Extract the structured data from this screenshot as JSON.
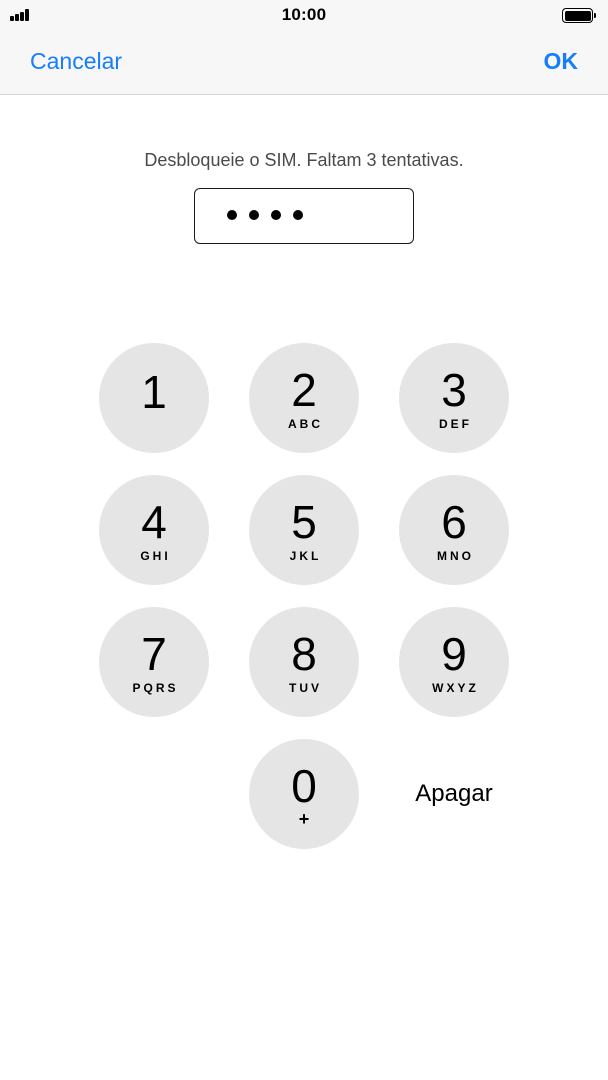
{
  "status_bar": {
    "time": "10:00",
    "signal_icon": "cellular-signal-icon",
    "battery_icon": "battery-full-icon"
  },
  "nav": {
    "cancel_label": "Cancelar",
    "ok_label": "OK",
    "accent_color": "#157efb"
  },
  "prompt": {
    "text": "Desbloqueie o SIM. Faltam 3 tentativas."
  },
  "pin_field": {
    "entered_digits_count": 4
  },
  "keypad": {
    "key_color": "#e5e5e5",
    "keys": [
      {
        "digit": "1",
        "letters": ""
      },
      {
        "digit": "2",
        "letters": "ABC"
      },
      {
        "digit": "3",
        "letters": "DEF"
      },
      {
        "digit": "4",
        "letters": "GHI"
      },
      {
        "digit": "5",
        "letters": "JKL"
      },
      {
        "digit": "6",
        "letters": "MNO"
      },
      {
        "digit": "7",
        "letters": "PQRS"
      },
      {
        "digit": "8",
        "letters": "TUV"
      },
      {
        "digit": "9",
        "letters": "WXYZ"
      },
      {
        "digit": "0",
        "letters": "+"
      }
    ],
    "delete_label": "Apagar"
  }
}
